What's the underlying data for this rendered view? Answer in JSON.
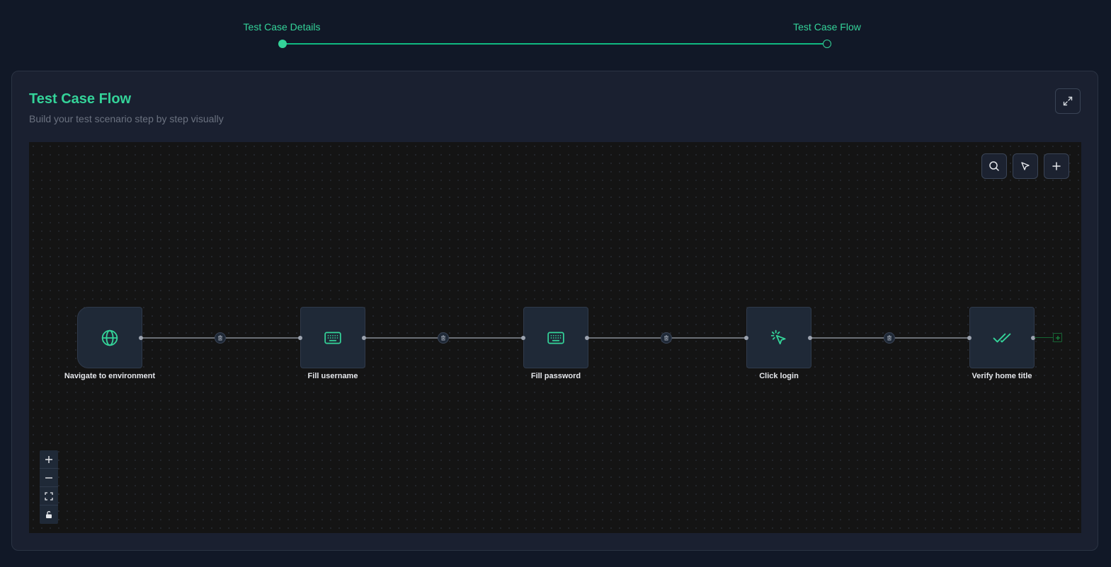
{
  "stepper": {
    "steps": [
      {
        "label": "Test Case Details",
        "state": "done"
      },
      {
        "label": "Test Case Flow",
        "state": "current"
      }
    ]
  },
  "card": {
    "title": "Test Case Flow",
    "subtitle": "Build your test scenario step by step visually",
    "expand_icon": "expand-icon"
  },
  "toolbar": {
    "tools": [
      "search-icon",
      "pointer-icon",
      "plus-icon"
    ]
  },
  "flow": {
    "nodes": [
      {
        "label": "Navigate to environment",
        "icon": "globe-icon"
      },
      {
        "label": "Fill username",
        "icon": "keyboard-icon"
      },
      {
        "label": "Fill password",
        "icon": "keyboard-icon"
      },
      {
        "label": "Click login",
        "icon": "click-icon"
      },
      {
        "label": "Verify home title",
        "icon": "double-check-icon"
      }
    ],
    "edge_delete_icon": "trash-icon",
    "add_node_icon": "plus-icon"
  },
  "zoom_controls": [
    "zoom-in-icon",
    "zoom-out-icon",
    "fit-view-icon",
    "lock-icon"
  ],
  "colors": {
    "accent": "#34d399",
    "background": "#111827",
    "card": "#1a2030",
    "canvas": "#141414",
    "node": "#1f2937"
  }
}
